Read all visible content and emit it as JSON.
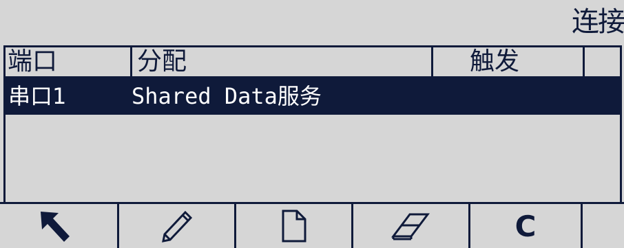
{
  "title": "连接",
  "table": {
    "headers": {
      "port": "端口",
      "assign": "分配",
      "trigger": "触发"
    },
    "rows": [
      {
        "port": "串口1",
        "assign": "Shared Data服务",
        "trigger": ""
      }
    ]
  },
  "softkeys": [
    {
      "icon": "exit-arrow-icon",
      "label": ""
    },
    {
      "icon": "pencil-icon",
      "label": ""
    },
    {
      "icon": "new-document-icon",
      "label": ""
    },
    {
      "icon": "eraser-icon",
      "label": ""
    },
    {
      "icon": "clear-c-icon",
      "label": "C"
    },
    {
      "icon": "",
      "label": ""
    }
  ],
  "colors": {
    "background": "#d6d6d6",
    "foreground": "#0f1a3a",
    "selected_text": "#ffffff"
  }
}
